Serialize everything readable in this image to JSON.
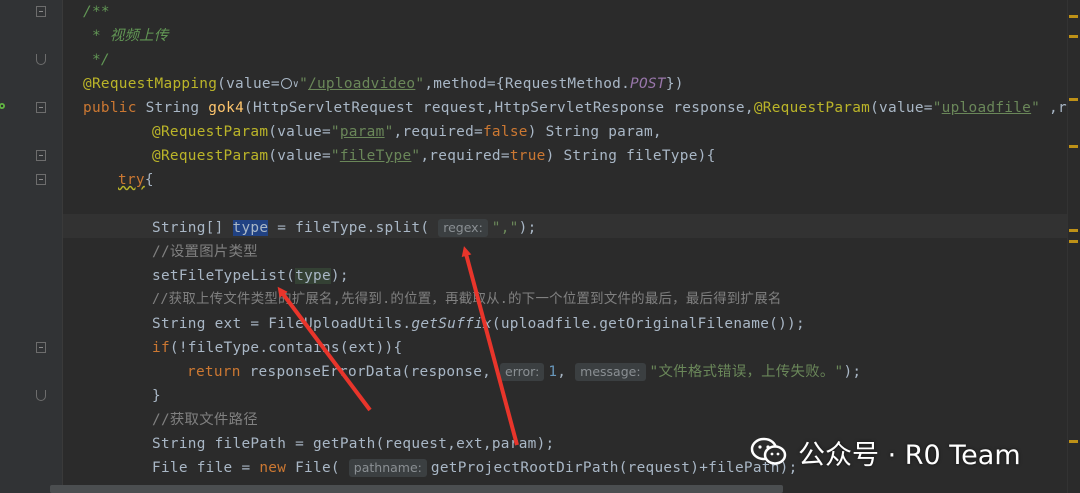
{
  "code": {
    "comment_open": "/**",
    "comment_body": " * 视频上传",
    "comment_close": " */",
    "mapping": {
      "annotation": "@RequestMapping",
      "p1": "(value=",
      "chevron": "∨",
      "q1": "\"",
      "path": "/uploadvideo",
      "q2": "\"",
      "p2": ",method={RequestMethod.",
      "method": "POST",
      "p3": "})"
    },
    "sig": {
      "public": "public",
      "p1": " String ",
      "name": "gok4",
      "p2": "(HttpServletRequest request,HttpServletResponse response,",
      "ann": "@RequestParam",
      "p3": "(value=",
      "q1": "\"",
      "value": "uploadfile",
      "q2": "\"",
      "p4": " ,requir"
    },
    "param1": {
      "ann": "@RequestParam",
      "p1": "(value=",
      "q1": "\"",
      "value": "param",
      "q2": "\"",
      "p2": ",required=",
      "bool": "false",
      "p3": ") String param,"
    },
    "param2": {
      "ann": "@RequestParam",
      "p1": "(value=",
      "q1": "\"",
      "value": "fileType",
      "q2": "\"",
      "p2": ",required=",
      "bool": "true",
      "p3": ") String fileType){"
    },
    "try_kw": "try",
    "try_brace": "{",
    "split": {
      "p1": "String[] ",
      "var": "type",
      "p2": " = fileType.split( ",
      "hint": "regex:",
      "str": "\",\"",
      "p3": ");"
    },
    "comment_type": "//设置图片类型",
    "set_type": {
      "fn": "setFileTypeList",
      "p1": "(",
      "var": "type",
      "p2": ");"
    },
    "comment_ext": "//获取上传文件类型的扩展名,先得到.的位置，再截取从.的下一个位置到文件的最后，最后得到扩展名",
    "ext": {
      "p1": "String ext = FileUploadUtils.",
      "fn": "getSuffix",
      "p2": "(uploadfile.getOriginalFilename());"
    },
    "if_line": {
      "kw": "if",
      "p1": "(!fileType.contains(ext)){"
    },
    "return_line": {
      "kw": "return",
      "p1": " responseErrorData(response, ",
      "hint1": "error:",
      "num": "1",
      "p2": ", ",
      "hint2": "message:",
      "str": "\"文件格式错误，上传失败。\"",
      "p3": ");"
    },
    "close_brace": "}",
    "comment_path": "//获取文件路径",
    "filepath": "String filePath = getPath(request,ext,param);",
    "file_line": {
      "p1": "File file = ",
      "kw": "new",
      "p2": " File( ",
      "hint": "pathname:",
      "p3": "getProjectRootDirPath(request)+filePath);"
    }
  },
  "watermark": {
    "text": "公众号 · R0 Team",
    "icon": "wechat-icon"
  },
  "colors": {
    "background": "#2b2b2b",
    "gutter": "#313335",
    "annotation": "#bbb529",
    "keyword": "#cc7832",
    "string": "#6a8759",
    "method": "#ffc66d",
    "arrow": "#e8352b"
  }
}
